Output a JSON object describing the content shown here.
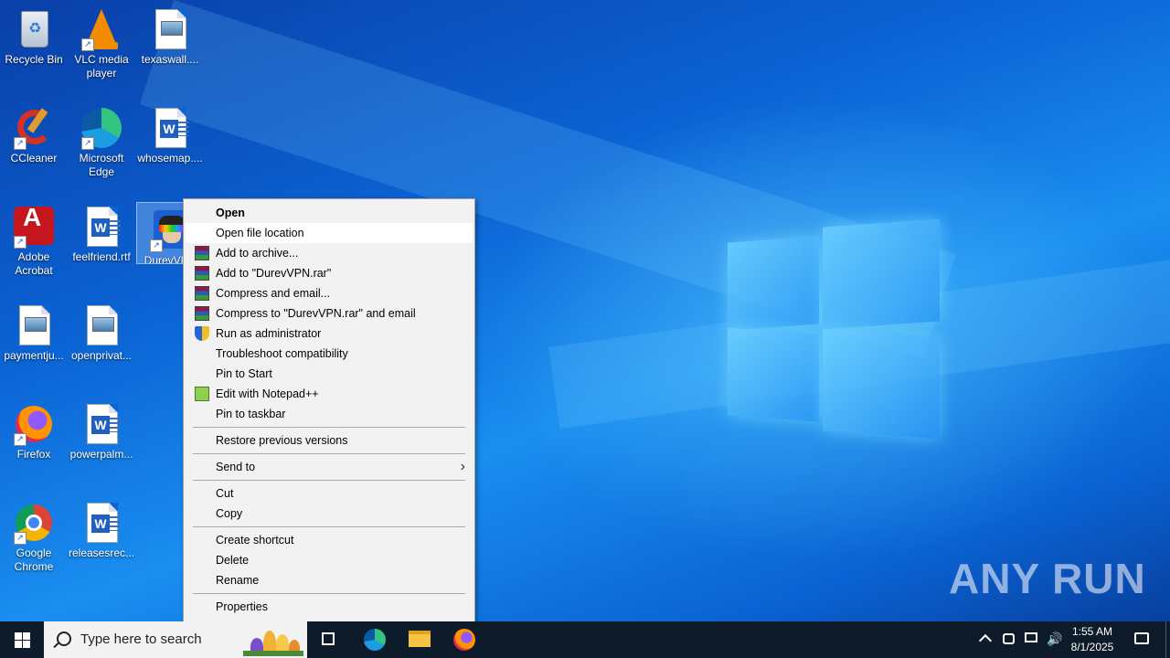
{
  "desktop": {
    "icons": [
      {
        "label": "Recycle Bin"
      },
      {
        "label": "VLC media player"
      },
      {
        "label": "texaswall...."
      },
      {
        "label": "CCleaner"
      },
      {
        "label": "Microsoft Edge"
      },
      {
        "label": "whosemap...."
      },
      {
        "label": "Adobe Acrobat"
      },
      {
        "label": "feelfriend.rtf"
      },
      {
        "label": "DurevVPN"
      },
      {
        "label": "paymentju..."
      },
      {
        "label": "openprivat..."
      },
      {
        "label": "Firefox"
      },
      {
        "label": "powerpalm..."
      },
      {
        "label": "Google Chrome"
      },
      {
        "label": "releasesrec..."
      }
    ]
  },
  "context_menu": {
    "items": [
      {
        "label": "Open"
      },
      {
        "label": "Open file location"
      },
      {
        "label": "Add to archive..."
      },
      {
        "label": "Add to \"DurevVPN.rar\""
      },
      {
        "label": "Compress and email..."
      },
      {
        "label": "Compress to \"DurevVPN.rar\" and email"
      },
      {
        "label": "Run as administrator"
      },
      {
        "label": "Troubleshoot compatibility"
      },
      {
        "label": "Pin to Start"
      },
      {
        "label": "Edit with Notepad++"
      },
      {
        "label": "Pin to taskbar"
      },
      {
        "label": "Restore previous versions"
      },
      {
        "label": "Send to"
      },
      {
        "label": "Cut"
      },
      {
        "label": "Copy"
      },
      {
        "label": "Create shortcut"
      },
      {
        "label": "Delete"
      },
      {
        "label": "Rename"
      },
      {
        "label": "Properties"
      }
    ]
  },
  "watermark": "ANY RUN",
  "taskbar": {
    "search_placeholder": "Type here to search",
    "clock": {
      "time": "1:55 AM",
      "date": "8/1/2025"
    }
  },
  "colors": {
    "taskbar": "#0d1b2a",
    "menu_bg": "#f2f2f2",
    "desktop_accent": "#0b63d4"
  }
}
